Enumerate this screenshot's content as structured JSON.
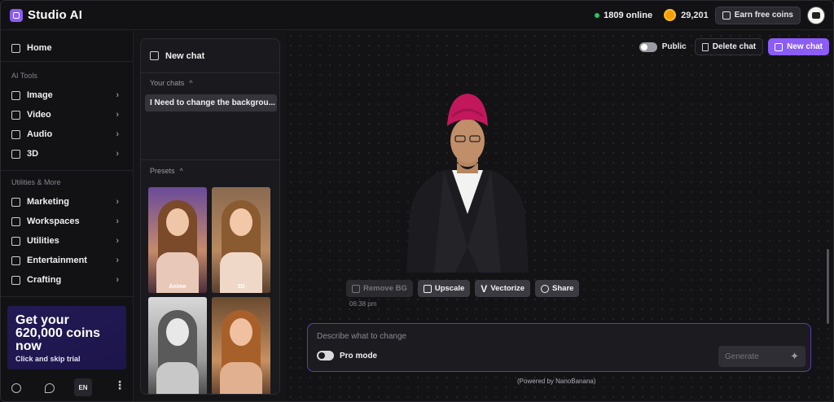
{
  "app": {
    "name": "Studio AI"
  },
  "topbar": {
    "online_count": "1809 online",
    "coins": "29,201",
    "earn_label": "Earn free coins"
  },
  "sidebar": {
    "home": "Home",
    "section_ai": "AI Tools",
    "ai_items": [
      "Image",
      "Video",
      "Audio",
      "3D"
    ],
    "section_util": "Utilities & More",
    "util_items": [
      "Marketing",
      "Workspaces",
      "Utilities",
      "Entertainment",
      "Crafting"
    ],
    "promo_title": "Get your\n620,000 coins\nnow",
    "promo_sub": "Click and skip trial",
    "lang": "EN"
  },
  "chat_panel": {
    "new_chat": "New chat",
    "your_chats": "Your chats",
    "chat_item": "I Need to change the backgrou...",
    "presets": "Presets",
    "preset_labels": [
      "Anime",
      "3D",
      "",
      ""
    ]
  },
  "main": {
    "public_label": "Public",
    "delete_label": "Delete chat",
    "new_label": "New chat",
    "actions": [
      "Remove BG",
      "Upscale",
      "Vectorize",
      "Share"
    ],
    "timestamp": "06:38 pm",
    "prompt_placeholder": "Describe what to change",
    "pro_mode": "Pro mode",
    "generate": "Generate",
    "powered_by": "(Powered by NanoBanana)"
  },
  "colors": {
    "accent": "#8b5cf6",
    "online": "#22c55e",
    "coin": "#f59e0b"
  }
}
